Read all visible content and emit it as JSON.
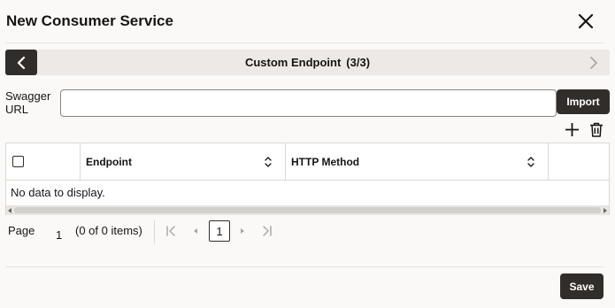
{
  "dialog": {
    "title": "New Consumer Service"
  },
  "train": {
    "label": "Custom Endpoint",
    "step": "(3/3)"
  },
  "swagger": {
    "label": "Swagger URL",
    "value": "",
    "placeholder": "",
    "import_label": "Import"
  },
  "table": {
    "columns": [
      "Endpoint",
      "HTTP Method"
    ],
    "rows": [],
    "empty_text": "No data to display."
  },
  "pager": {
    "page_label": "Page",
    "page_number": "1",
    "range_text": "(0 of 0 items)",
    "current_page": "1"
  },
  "footer": {
    "save_label": "Save"
  },
  "icons": {
    "close": "close-icon",
    "prev": "chevron-left-icon",
    "next": "chevron-right-icon",
    "add": "plus-icon",
    "delete": "trash-icon",
    "sort": "sort-icon"
  },
  "colors": {
    "primary_button": "#312d2a",
    "background": "#fbf9f8",
    "train_bar": "#ece9e6"
  }
}
